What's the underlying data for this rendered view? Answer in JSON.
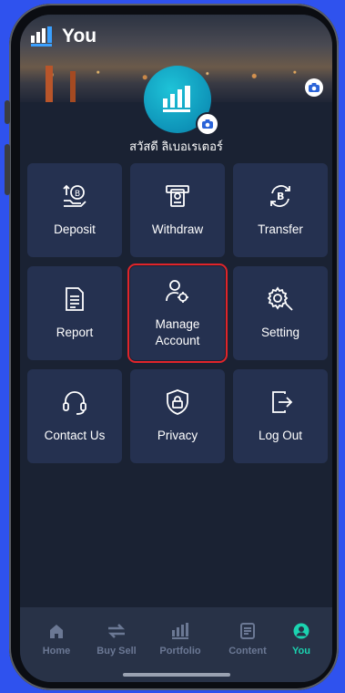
{
  "header": {
    "title": "You"
  },
  "profile": {
    "greeting": "สวัสดี ลิเบอเรเตอร์"
  },
  "menu": [
    {
      "label": "Deposit",
      "icon": "deposit-icon"
    },
    {
      "label": "Withdraw",
      "icon": "withdraw-icon"
    },
    {
      "label": "Transfer",
      "icon": "transfer-icon"
    },
    {
      "label": "Report",
      "icon": "report-icon"
    },
    {
      "label": "Manage\nAccount",
      "icon": "manage-account-icon",
      "highlighted": true
    },
    {
      "label": "Setting",
      "icon": "gear-icon"
    },
    {
      "label": "Contact Us",
      "icon": "headset-icon"
    },
    {
      "label": "Privacy",
      "icon": "shield-lock-icon"
    },
    {
      "label": "Log Out",
      "icon": "logout-icon"
    }
  ],
  "nav": [
    {
      "label": "Home",
      "icon": "home-icon"
    },
    {
      "label": "Buy Sell",
      "icon": "swap-icon"
    },
    {
      "label": "Portfolio",
      "icon": "portfolio-icon"
    },
    {
      "label": "Content",
      "icon": "content-icon"
    },
    {
      "label": "You",
      "icon": "user-icon",
      "active": true
    }
  ],
  "colors": {
    "background": "#2f52ee",
    "screen": "#1a2233",
    "tile": "#253150",
    "highlight": "#e0242a",
    "active_nav": "#1bd3b0",
    "inactive_nav": "#6b7894"
  }
}
